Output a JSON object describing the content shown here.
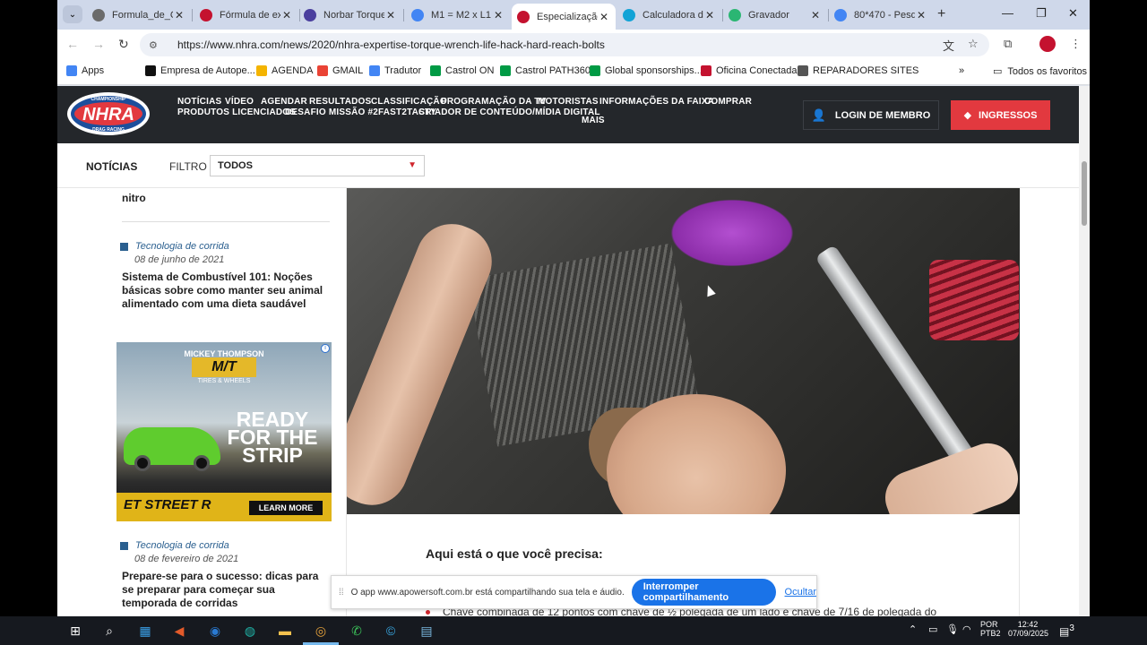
{
  "browser": {
    "tabs": [
      {
        "title": "Formula_de_C",
        "favicon_color": "#6b6b6b",
        "active": false
      },
      {
        "title": "Fórmula de ex",
        "favicon_color": "#c4122f",
        "active": false
      },
      {
        "title": "Norbar Torque",
        "favicon_color": "#4a3f9e",
        "active": false
      },
      {
        "title": "M1 = M2 x L1",
        "favicon_color": "#4285f4",
        "active": false
      },
      {
        "title": "Especialização",
        "favicon_color": "#c4122f",
        "active": true
      },
      {
        "title": "Calculadora d",
        "favicon_color": "#12a3d6",
        "active": false
      },
      {
        "title": "Gravador",
        "favicon_color": "#2bb673",
        "active": false
      },
      {
        "title": "80*470 - Pesq",
        "favicon_color": "#4285f4",
        "active": false
      }
    ],
    "url": "https://www.nhra.com/news/2020/nhra-expertise-torque-wrench-life-hack-hard-reach-bolts",
    "bookmarks": [
      {
        "label": "Apps",
        "color": "#4285f4"
      },
      {
        "label": "Empresa de Autope...",
        "color": "#111111"
      },
      {
        "label": "AGENDA",
        "color": "#f4b400"
      },
      {
        "label": "GMAIL",
        "color": "#ea4335"
      },
      {
        "label": "Tradutor",
        "color": "#4285f4"
      },
      {
        "label": "Castrol ON",
        "color": "#009a44"
      },
      {
        "label": "Castrol PATH360",
        "color": "#009a44"
      },
      {
        "label": "Global sponsorships...",
        "color": "#009a44"
      },
      {
        "label": "Oficina Conectada",
        "color": "#c4122f"
      },
      {
        "label": "REPARADORES SITES",
        "color": "#555555"
      }
    ],
    "all_bookmarks": "Todos os favoritos"
  },
  "site": {
    "logo_text": "NHRA",
    "logo_top": "CHAMPIONSHIP",
    "logo_bottom": "DRAG RACING",
    "nav_row1": [
      "NOTÍCIAS",
      "VÍDEO",
      "AGENDAR",
      "RESULTADOS",
      "CLASSIFICAÇÃO",
      "PROGRAMAÇÃO DA TV",
      "MOTORISTAS",
      "INFORMAÇÕES DA FAIXA",
      "COMPRAR"
    ],
    "nav_row2": [
      "PRODUTOS LICENCIADOS",
      "DESAFIO MISSÃO #2FAST2TASTY",
      "CRIADOR DE CONTEÚDO/MÍDIA DIGITAL"
    ],
    "nav_row3": [
      "MAIS"
    ],
    "login_label": "LOGIN DE MEMBRO",
    "tickets_label": "INGRESSOS",
    "accent": "#e2393f",
    "filter": {
      "section_label": "NOTÍCIAS",
      "filter_label": "FILTRO",
      "selected": "TODOS"
    }
  },
  "sidebar": {
    "snippet_end": "nitro",
    "items": [
      {
        "category": "Tecnologia de corrida",
        "date": "08 de junho de 2021",
        "title": "Sistema de Combustível 101: Noções básicas sobre como manter seu animal alimentado com uma dieta saudável"
      },
      {
        "category": "Tecnologia de corrida",
        "date": "08 de fevereiro de 2021",
        "title": "Prepare-se para o sucesso: dicas para se preparar para começar sua temporada de corridas"
      }
    ],
    "ad": {
      "brand": "MICKEY THOMPSON",
      "logo": "M/T",
      "sub": "TIRES & WHEELS",
      "headline": [
        "READY",
        "FOR THE",
        "STRIP"
      ],
      "product": "ET STREET R",
      "cta": "LEARN MORE"
    }
  },
  "article": {
    "heading": "Aqui está o que você precisa:",
    "bullet": "Chave combinada de 12 pontos com chave de ½ polegada de um lado e chave de 7/16 de polegada do"
  },
  "sharebar": {
    "message": "O app www.apowersoft.com.br está compartilhando sua tela e áudio.",
    "stop_label": "Interromper compartilhamento",
    "hide_label": "Ocultar"
  },
  "taskbar": {
    "lang": "POR",
    "layout": "PTB2",
    "time": "12:42",
    "date": "07/09/2025",
    "notifications": "3"
  }
}
